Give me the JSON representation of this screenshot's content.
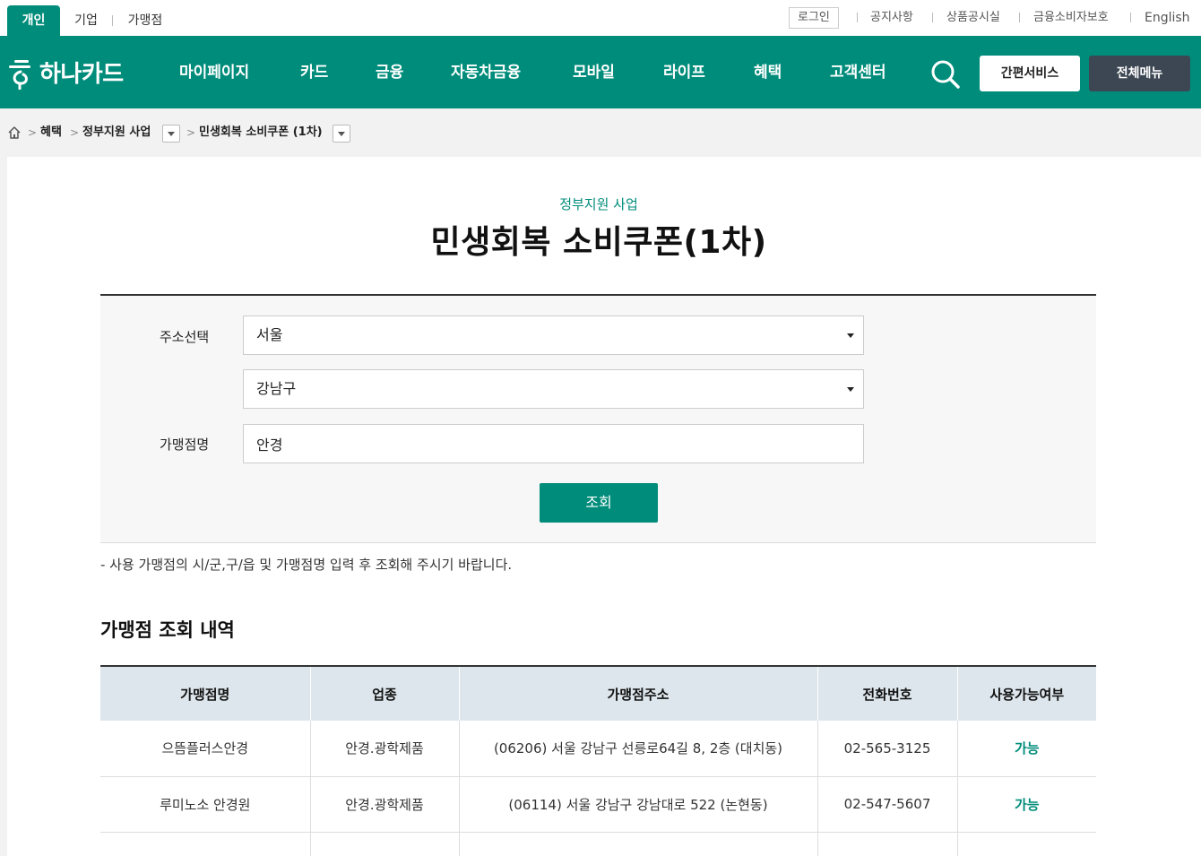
{
  "top_tabs": [
    {
      "label": "개인",
      "active": true
    },
    {
      "label": "기업",
      "active": false
    },
    {
      "label": "가맹점",
      "active": false
    }
  ],
  "util_links": {
    "login": "로그인",
    "notice": "공지사항",
    "product": "상품공시실",
    "consumer": "금융소비자보호",
    "english": "English"
  },
  "brand": {
    "name": "하나카드",
    "color": "#008c7a"
  },
  "nav": [
    "마이페이지",
    "카드",
    "금융",
    "자동차금융",
    "모바일",
    "라이프",
    "혜택",
    "고객센터"
  ],
  "header_buttons": {
    "quick": "간편서비스",
    "all_menu": "전체메뉴"
  },
  "breadcrumb": {
    "level1": "혜택",
    "level2": "정부지원 사업",
    "level3": "민생회복 소비쿠폰 (1차)"
  },
  "page": {
    "subtitle": "정부지원 사업",
    "title": "민생회복 소비쿠폰(1차)"
  },
  "search": {
    "address_label": "주소선택",
    "city": "서울",
    "district": "강남구",
    "store_label": "가맹점명",
    "store_value": "안경",
    "submit": "조회"
  },
  "notice": "- 사용 가맹점의 시/군,구/읍 및 가맹점명 입력 후 조회해 주시기 바랍니다.",
  "results": {
    "title": "가맹점 조회 내역",
    "headers": [
      "가맹점명",
      "업종",
      "가맹점주소",
      "전화번호",
      "사용가능여부"
    ],
    "rows": [
      {
        "name": "으뜸플러스안경",
        "type": "안경.광학제품",
        "address": "(06206) 서울 강남구 선릉로64길 8, 2층 (대치동)",
        "phone": "02-565-3125",
        "status": "가능"
      },
      {
        "name": "루미노소 안경원",
        "type": "안경.광학제품",
        "address": "(06114) 서울 강남구 강남대로 522 (논현동)",
        "phone": "02-547-5607",
        "status": "가능"
      }
    ]
  }
}
